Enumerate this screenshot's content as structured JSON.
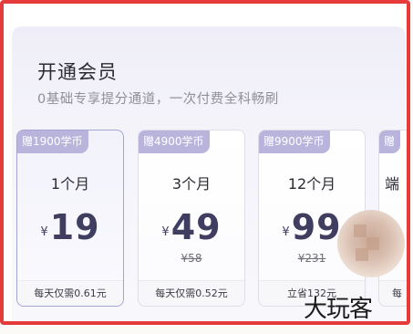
{
  "header": {
    "title": "开通会员",
    "subtitle": "0基础专享提分通道，一次付费全科畅刷"
  },
  "plans": [
    {
      "tag": "赠1900学币",
      "duration": "1个月",
      "currency": "¥",
      "price": "19",
      "original": "",
      "note": "每天仅需0.61元",
      "selected": true
    },
    {
      "tag": "赠4900学币",
      "duration": "3个月",
      "currency": "¥",
      "price": "49",
      "original": "¥58",
      "note": "每天仅需0.52元",
      "selected": false
    },
    {
      "tag": "赠9900学币",
      "duration": "12个月",
      "currency": "¥",
      "price": "99",
      "original": "¥231",
      "note": "立省132元",
      "selected": false
    },
    {
      "tag": "赠",
      "duration": "端",
      "currency": "",
      "price": "",
      "original": "",
      "note": "每",
      "selected": false
    }
  ],
  "watermark": "大玩客",
  "colors": {
    "border_highlight": "#e63b3b",
    "tag_bg": "#b8b4dc",
    "price": "#3f3d60"
  }
}
